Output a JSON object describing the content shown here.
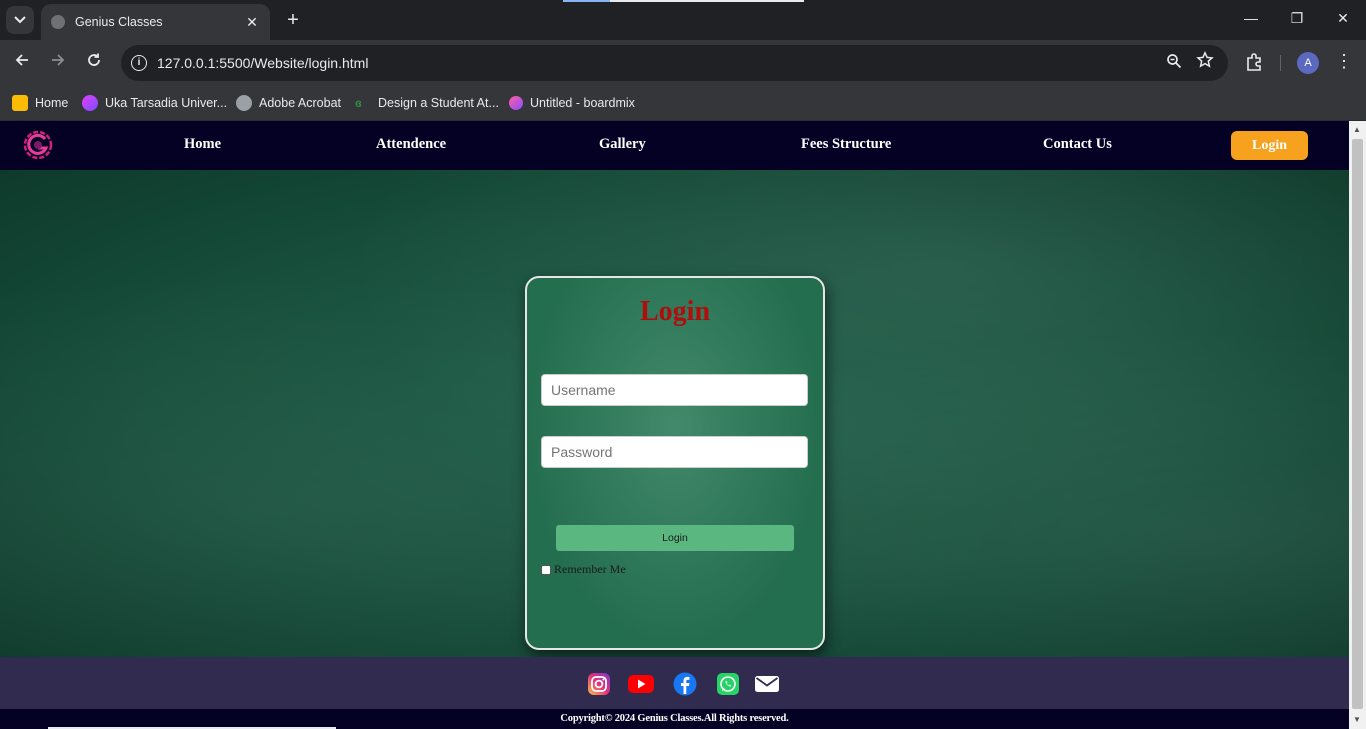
{
  "browser": {
    "tab_title": "Genius Classes",
    "tab_close": "✕",
    "new_tab": "+",
    "url": "127.0.0.1:5500/Website/login.html",
    "window_controls": {
      "minimize": "—",
      "restore": "❐",
      "close": "✕"
    },
    "profile_initial": "A",
    "bookmarks": [
      {
        "label": "Home",
        "icon": "home-bookmark-icon",
        "color": "#fbbc04"
      },
      {
        "label": "Uka Tarsadia Univer...",
        "icon": "utu-logo-icon",
        "color": "#e040fb"
      },
      {
        "label": "Adobe Acrobat",
        "icon": "globe-icon",
        "color": "#9aa0a6"
      },
      {
        "label": "Design a Student At...",
        "icon": "gfg-icon",
        "color": "#2f8d46"
      },
      {
        "label": "Untitled - boardmix",
        "icon": "boardmix-icon",
        "color": "#b44cf0"
      }
    ]
  },
  "site": {
    "nav": {
      "links": [
        "Home",
        "Attendence",
        "Gallery",
        "Fees Structure",
        "Contact Us"
      ],
      "login_button": "Login"
    },
    "login_card": {
      "title": "Login",
      "username_placeholder": "Username",
      "password_placeholder": "Password",
      "submit_label": "Login",
      "remember_label": "Remember Me"
    },
    "footer": {
      "social_icons": [
        "instagram-icon",
        "youtube-icon",
        "facebook-icon",
        "whatsapp-icon",
        "email-icon"
      ],
      "copyright": "Copyright© 2024 Genius Classes.All Rights reserved."
    },
    "colors": {
      "nav_bg": "#050125",
      "accent_orange": "#f6a21e",
      "title_red": "#b20d0d",
      "button_green": "#5bb780",
      "footer_bg": "#302b4f"
    }
  }
}
